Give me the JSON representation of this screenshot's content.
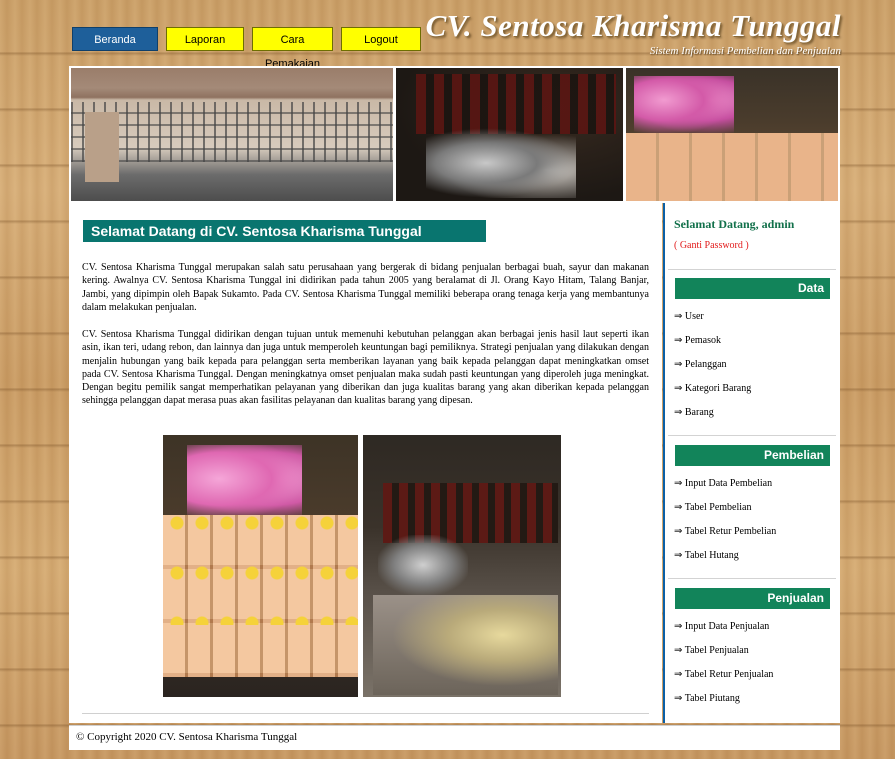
{
  "header": {
    "brand": "CV. Sentosa Kharisma Tunggal",
    "tagline": "Sistem Informasi Pembelian dan Penjualan",
    "nav": [
      "Beranda",
      "Laporan",
      "Cara Pemakaian",
      "Logout"
    ]
  },
  "main": {
    "title": "Selamat Datang di CV. Sentosa Kharisma Tunggal",
    "paragraph1": "CV. Sentosa Kharisma Tunggal merupakan salah satu perusahaan yang bergerak di bidang penjualan berbagai buah, sayur dan makanan kering. Awalnya CV. Sentosa Kharisma Tunggal ini didirikan pada tahun 2005 yang beralamat di Jl. Orang Kayo Hitam, Talang Banjar, Jambi, yang dipimpin oleh Bapak Sukamto. Pada CV. Sentosa Kharisma Tunggal memiliki beberapa orang tenaga kerja yang membantunya dalam melakukan penjualan.",
    "paragraph2": "CV. Sentosa Kharisma Tunggal didirikan dengan tujuan untuk memenuhi kebutuhan pelanggan akan berbagai jenis hasil laut seperti ikan asin, ikan teri, udang rebon, dan lainnya dan juga untuk memperoleh keuntungan bagi pemiliknya. Strategi penjualan yang dilakukan dengan menjalin hubungan yang baik kepada para pelanggan serta memberikan layanan yang baik kepada pelanggan dapat meningkatkan omset pada CV. Sentosa Kharisma Tunggal. Dengan meningkatnya omset penjualan maka sudah pasti keuntungan yang diperoleh juga meningkat. Dengan begitu pemilik sangat memperhatikan pelayanan yang diberikan dan juga kualitas barang yang akan diberikan kepada pelanggan sehingga pelanggan dapat merasa puas akan fasilitas pelayanan dan kualitas barang yang dipesan."
  },
  "sidebar": {
    "greeting": "Selamat Datang, admin",
    "change_password": "( Ganti Password )",
    "sections": [
      {
        "title": "Data",
        "items": [
          "⇒ User",
          "⇒ Pemasok",
          "⇒ Pelanggan",
          "⇒ Kategori Barang",
          "⇒ Barang"
        ]
      },
      {
        "title": "Pembelian",
        "items": [
          "⇒ Input Data Pembelian",
          "⇒ Tabel Pembelian",
          "⇒ Tabel Retur Pembelian",
          "⇒ Tabel Hutang"
        ]
      },
      {
        "title": "Penjualan",
        "items": [
          "⇒ Input Data Penjualan",
          "⇒ Tabel Penjualan",
          "⇒ Tabel Retur Penjualan",
          "⇒ Tabel Piutang"
        ]
      }
    ]
  },
  "footer": {
    "copyright": "© Copyright 2020 CV. Sentosa Kharisma Tunggal"
  },
  "colors": {
    "nav_active": "#1e5f9a",
    "nav_button": "#ffff00",
    "title_bar": "#09756f",
    "section_head": "#12845a",
    "greeting": "#11704a",
    "change_password": "#e21b1b"
  }
}
